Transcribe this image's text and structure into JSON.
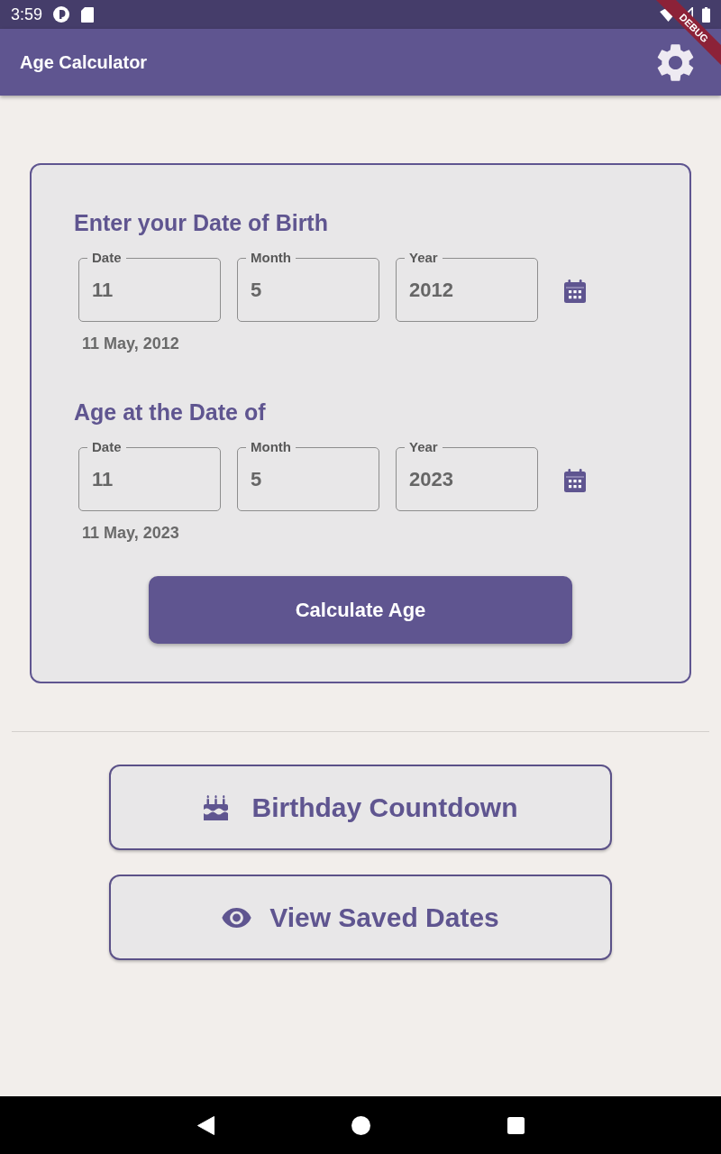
{
  "status_bar": {
    "time": "3:59"
  },
  "debug_banner": {
    "label": "DEBUG"
  },
  "app_bar": {
    "title": "Age Calculator"
  },
  "sections": [
    {
      "heading": "Enter your Date of Birth",
      "fields": [
        {
          "label": "Date",
          "value": "11"
        },
        {
          "label": "Month",
          "value": "5"
        },
        {
          "label": "Year",
          "value": "2012"
        }
      ],
      "summary": "11 May, 2012"
    },
    {
      "heading": "Age at the Date of",
      "fields": [
        {
          "label": "Date",
          "value": "11"
        },
        {
          "label": "Month",
          "value": "5"
        },
        {
          "label": "Year",
          "value": "2023"
        }
      ],
      "summary": "11 May, 2023"
    }
  ],
  "calculate_button": {
    "label": "Calculate Age"
  },
  "actions": [
    {
      "label": "Birthday Countdown"
    },
    {
      "label": "View Saved Dates"
    }
  ]
}
